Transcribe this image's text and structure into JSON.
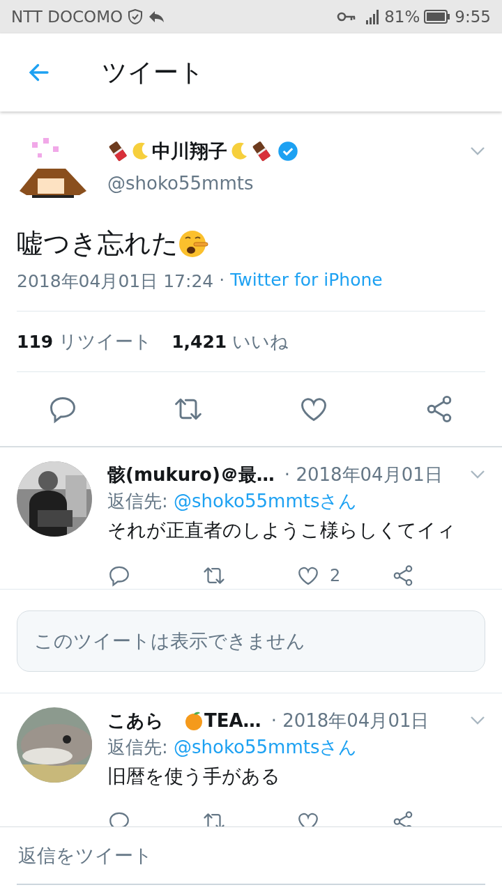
{
  "status_bar": {
    "carrier": "NTT DOCOMO",
    "battery": "81%",
    "time": "9:55"
  },
  "header": {
    "title": "ツイート"
  },
  "tweet": {
    "name": "中川翔子",
    "verified": true,
    "handle": "@shoko55mmts",
    "text": "嘘つき忘れた",
    "date": "2018年04月01日 17:24",
    "separator": "·",
    "source": "Twitter for iPhone",
    "retweets": "119",
    "retweets_label": "リツイート",
    "likes": "1,421",
    "likes_label": "いいね"
  },
  "replies": [
    {
      "kind": "reply",
      "name": "骸(mukuro)＠最…",
      "date": "· 2018年04月01日",
      "reply_label": "返信先:",
      "reply_to": "@shoko55mmtsさん",
      "text": "それが正直者のしようこ様らしくてイィ",
      "likes": "2"
    },
    {
      "kind": "unavailable",
      "text": "このツイートは表示できません"
    },
    {
      "kind": "reply",
      "name": "こあら",
      "name_extra": "TEA…",
      "date": "· 2018年04月01日",
      "reply_label": "返信先:",
      "reply_to": "@shoko55mmtsさん",
      "text": "旧暦を使う手がある"
    }
  ],
  "compose": {
    "placeholder": "返信をツイート"
  }
}
